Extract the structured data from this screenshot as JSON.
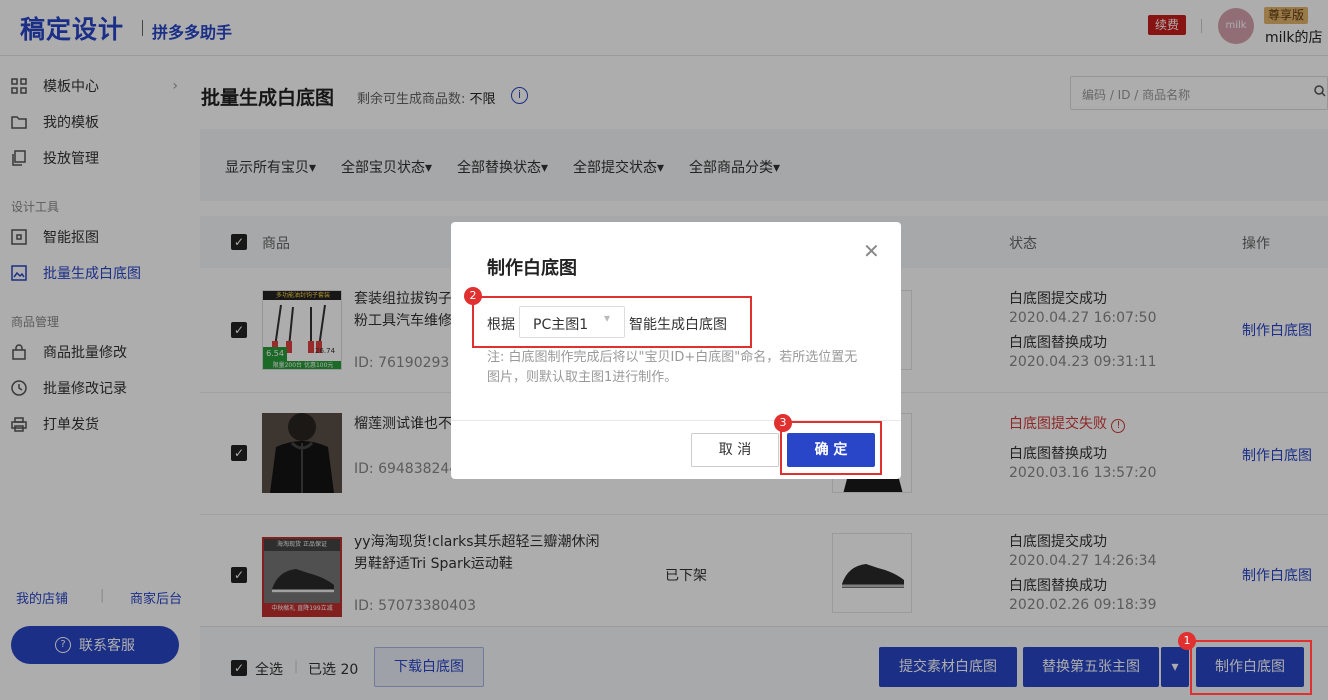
{
  "header": {
    "logo": "稿定设计",
    "sub_brand": "拼多多助手",
    "renew": "续费",
    "avatar_text": "milk",
    "vip": "尊享版",
    "shop_name": "milk的店"
  },
  "sidebar": {
    "items": [
      {
        "label": "模板中心",
        "icon": "grid-icon"
      },
      {
        "label": "我的模板",
        "icon": "folder-icon"
      },
      {
        "label": "投放管理",
        "icon": "copy-icon"
      },
      {
        "label": "智能抠图",
        "icon": "cutout-icon"
      },
      {
        "label": "批量生成白底图",
        "icon": "image-icon"
      },
      {
        "label": "商品批量修改",
        "icon": "bag-icon"
      },
      {
        "label": "批量修改记录",
        "icon": "clock-icon"
      },
      {
        "label": "打单发货",
        "icon": "printer-icon"
      }
    ],
    "group_design": "设计工具",
    "group_goods": "商品管理",
    "link_shop": "我的店铺",
    "link_backend": "商家后台",
    "service_button": "联系客服"
  },
  "page": {
    "title": "批量生成白底图",
    "quota_label": "剩余可生成商品数:",
    "quota_value": "不限",
    "search_placeholder": "编码 / ID / 商品名称"
  },
  "filters": [
    "显示所有宝贝▾",
    "全部宝贝状态▾",
    "全部替换状态▾",
    "全部提交状态▾",
    "全部商品分类▾"
  ],
  "table": {
    "col_product": "商品",
    "col_status": "状态",
    "col_action": "操作",
    "rows": [
      {
        "name_line1": "套装组拉拔钩子",
        "name_line2": "粉工具汽车维修",
        "id": "ID: 761902931",
        "shelf": "",
        "status1": "白底图提交成功",
        "time1": "2020.04.27 16:07:50",
        "status2": "白底图替换成功",
        "time2": "2020.04.23 09:31:11",
        "action": "制作白底图",
        "thumb_top": "多功能油封钩子套装",
        "thumb_price1": "6.54",
        "thumb_price2": "26.74",
        "thumb_bottom": "限量200台 优惠100元"
      },
      {
        "name_line1": "榴莲测试谁也不",
        "name_line2": "",
        "id": "ID: 69483824400",
        "shelf": "",
        "status1": "白底图提交失败",
        "time1": "",
        "status2": "白底图替换成功",
        "time2": "2020.03.16 13:57:20",
        "action": "制作白底图"
      },
      {
        "name_line1": "yy海淘现货!clarks其乐超轻三瓣潮休闲",
        "name_line2": "男鞋舒适Tri Spark运动鞋",
        "id": "ID: 57073380403",
        "shelf": "已下架",
        "status1": "白底图提交成功",
        "time1": "2020.04.27 14:26:34",
        "status2": "白底图替换成功",
        "time2": "2020.02.26 09:18:39",
        "action": "制作白底图",
        "thumb_top": "海淘现货 正品保证",
        "thumb_bottom": "中秋献礼 直降199立减"
      }
    ]
  },
  "bottom_bar": {
    "select_all": "全选",
    "selected": "已选 20",
    "download": "下载白底图",
    "submit": "提交素材白底图",
    "replace": "替换第五张主图",
    "make": "制作白底图"
  },
  "modal": {
    "title": "制作白底图",
    "prefix": "根据",
    "select_value": "PC主图1",
    "suffix": "智能生成白底图",
    "note": "注: 白底图制作完成后将以\"宝贝ID+白底图\"命名，若所选位置无图片，则默认取主图1进行制作。",
    "cancel": "取 消",
    "confirm": "确 定"
  },
  "annotations": [
    "1",
    "2",
    "3"
  ],
  "colors": {
    "accent": "#2a46c8",
    "danger": "#d03a3a",
    "highlight": "#e03030"
  }
}
